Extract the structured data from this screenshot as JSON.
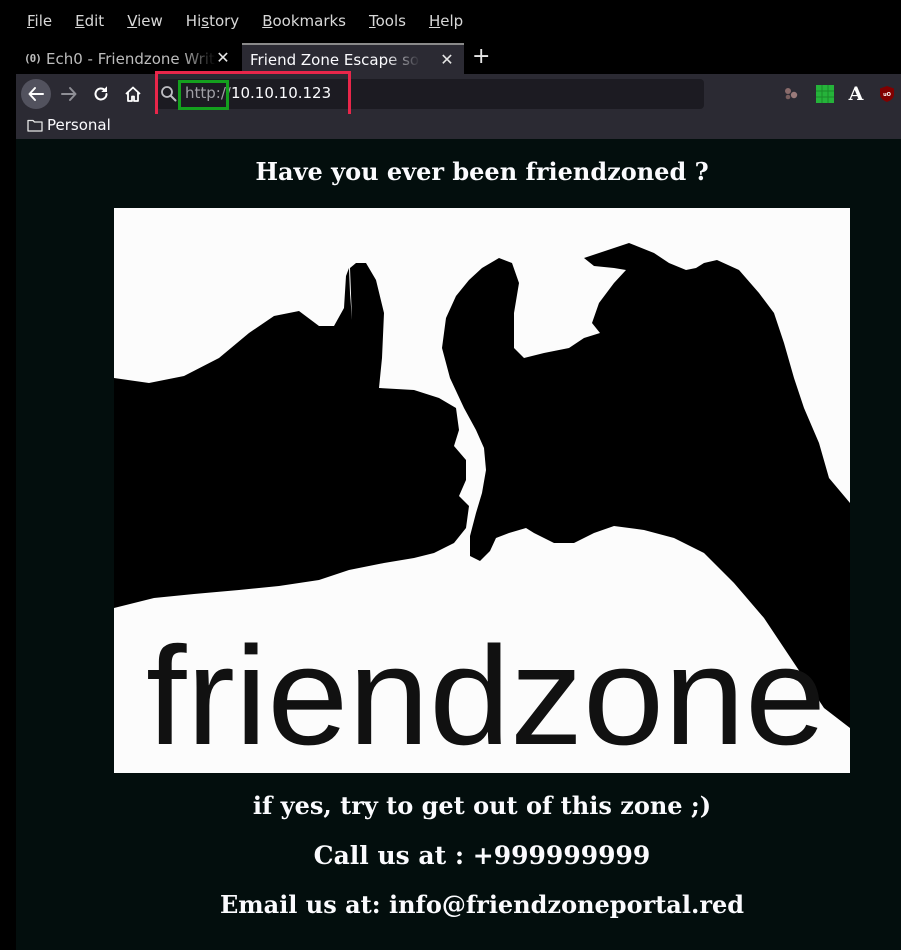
{
  "menu": [
    "File",
    "Edit",
    "View",
    "History",
    "Bookmarks",
    "Tools",
    "Help"
  ],
  "menu_accels": [
    "F",
    "E",
    "V",
    "s",
    "B",
    "T",
    "H"
  ],
  "tabs": [
    {
      "favicon": "(0)",
      "title": "Ech0 - Friendzone Writ"
    },
    {
      "title": "Friend Zone Escape softw"
    }
  ],
  "url": {
    "scheme": "http://",
    "host": "10.10.10.123"
  },
  "bookmarks": [
    {
      "label": "Personal"
    }
  ],
  "extensions": [
    "cookie-extension-icon",
    "grid-extension-icon",
    "font-extension-icon",
    "ublock-origin-icon"
  ],
  "colors": {
    "highlight_red": "#e8264a",
    "highlight_green": "#14a01e",
    "page_bg": "#030e0d"
  },
  "page": {
    "title": "Have you ever been friendzoned ?",
    "logo_text": "friendzone",
    "line1": "if yes, try to get out of this zone ;)",
    "line2": "Call us at : +999999999",
    "line3": "Email us at: info@friendzoneportal.red"
  }
}
